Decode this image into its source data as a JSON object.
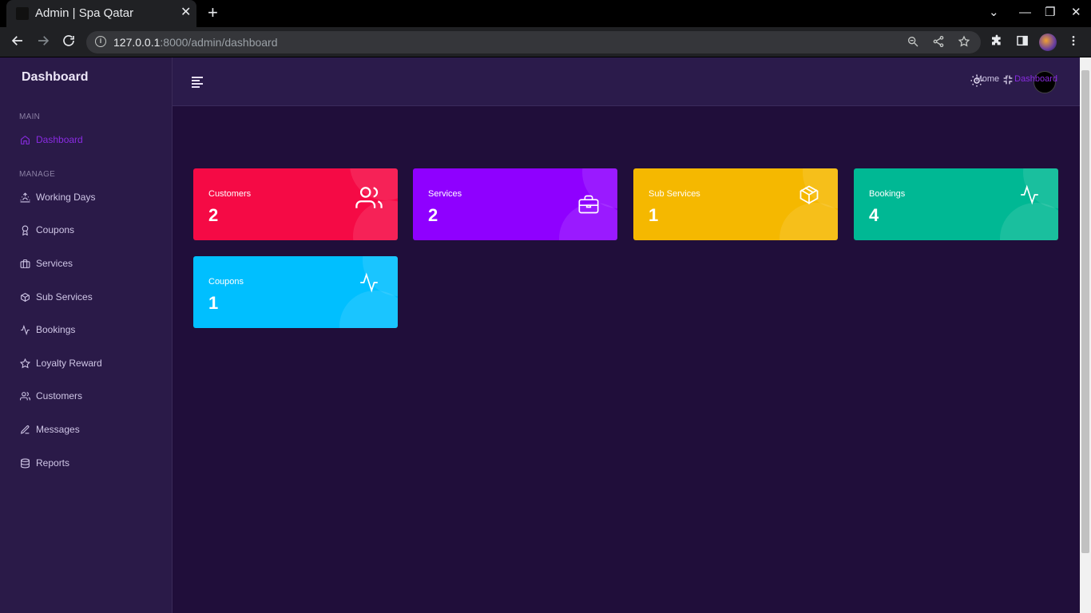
{
  "browser": {
    "tab_title": "Admin | Spa Qatar",
    "tab_close": "✕",
    "new_tab": "+",
    "url_host": "127.0.0.1",
    "url_rest": ":8000/admin/dashboard",
    "win_minimize": "—",
    "win_restore": "❐",
    "win_close": "✕",
    "win_dropdown": "⌄"
  },
  "sidebar": {
    "sections": [
      {
        "label": "MAIN"
      },
      {
        "label": "MANAGE"
      }
    ],
    "items": [
      {
        "label": "Dashboard",
        "icon": "home-icon",
        "active": true
      },
      {
        "label": "Working Days",
        "icon": "sunrise-icon"
      },
      {
        "label": "Coupons",
        "icon": "award-icon"
      },
      {
        "label": "Services",
        "icon": "briefcase-icon"
      },
      {
        "label": "Sub Services",
        "icon": "box-icon"
      },
      {
        "label": "Bookings",
        "icon": "activity-icon"
      },
      {
        "label": "Loyalty Reward",
        "icon": "star-icon"
      },
      {
        "label": "Customers",
        "icon": "users-icon"
      },
      {
        "label": "Messages",
        "icon": "edit-icon"
      },
      {
        "label": "Reports",
        "icon": "database-icon"
      }
    ]
  },
  "header": {
    "icons": [
      "menu-icon",
      "sun-icon",
      "minimize-icon",
      "avatar"
    ]
  },
  "page": {
    "title": "Dashboard",
    "breadcrumb": {
      "home": "Home",
      "separator": "/",
      "current": "Dashboard"
    }
  },
  "cards": [
    {
      "label": "Customers",
      "value": "2",
      "color": "#f50a45",
      "icon": "users-icon"
    },
    {
      "label": "Services",
      "value": "2",
      "color": "#8f00ff",
      "icon": "briefcase-icon"
    },
    {
      "label": "Sub Services",
      "value": "1",
      "color": "#f5b800",
      "icon": "box-icon"
    },
    {
      "label": "Bookings",
      "value": "4",
      "color": "#00b894",
      "icon": "activity-icon"
    },
    {
      "label": "Coupons",
      "value": "1",
      "color": "#00bfff",
      "icon": "activity-icon"
    }
  ],
  "colors": {
    "background": "#200e3a",
    "sidebar": "#2a1a48",
    "accent": "#8a2be2"
  }
}
